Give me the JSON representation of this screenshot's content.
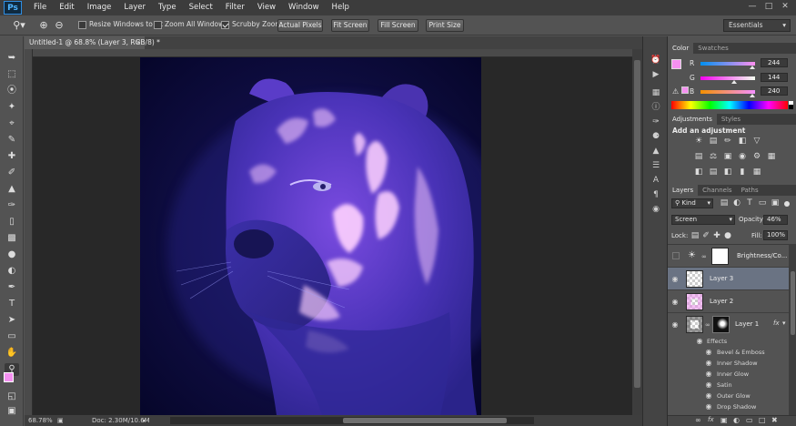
{
  "app": {
    "logo": "Ps"
  },
  "menu": [
    "File",
    "Edit",
    "Image",
    "Layer",
    "Type",
    "Select",
    "Filter",
    "View",
    "Window",
    "Help"
  ],
  "options": {
    "resize_windows": "Resize Windows to Fit",
    "zoom_all": "Zoom All Windows",
    "scrubby_zoom": "Scrubby Zoom",
    "buttons": [
      "Actual Pixels",
      "Fit Screen",
      "Fill Screen",
      "Print Size"
    ],
    "workspace": "Essentials"
  },
  "document": {
    "tab_title": "Untitled-1 @ 68.8% (Layer 3, RGB/8) *",
    "zoom": "68.78%",
    "doc_size": "Doc: 2.30M/10.6M"
  },
  "color_panel": {
    "tabs": [
      "Color",
      "Swatches"
    ],
    "channels": [
      {
        "label": "R",
        "value": "244"
      },
      {
        "label": "G",
        "value": "144"
      },
      {
        "label": "B",
        "value": "240"
      }
    ],
    "foreground": "#f490f0"
  },
  "adjustments_panel": {
    "tabs": [
      "Adjustments",
      "Styles"
    ],
    "heading": "Add an adjustment"
  },
  "layers_panel": {
    "tabs": [
      "Layers",
      "Channels",
      "Paths"
    ],
    "filter": "Kind",
    "blend_mode": "Screen",
    "opacity_label": "Opacity:",
    "opacity": "46%",
    "lock_label": "Lock:",
    "fill_label": "Fill:",
    "fill": "100%",
    "layers": [
      {
        "name": "Brightness/Co..."
      },
      {
        "name": "Layer 3"
      },
      {
        "name": "Layer 2"
      },
      {
        "name": "Layer 1"
      }
    ],
    "effects_label": "Effects",
    "effects": [
      "Bevel & Emboss",
      "Inner Shadow",
      "Inner Glow",
      "Satin",
      "Outer Glow",
      "Drop Shadow"
    ],
    "fx": "fx"
  }
}
